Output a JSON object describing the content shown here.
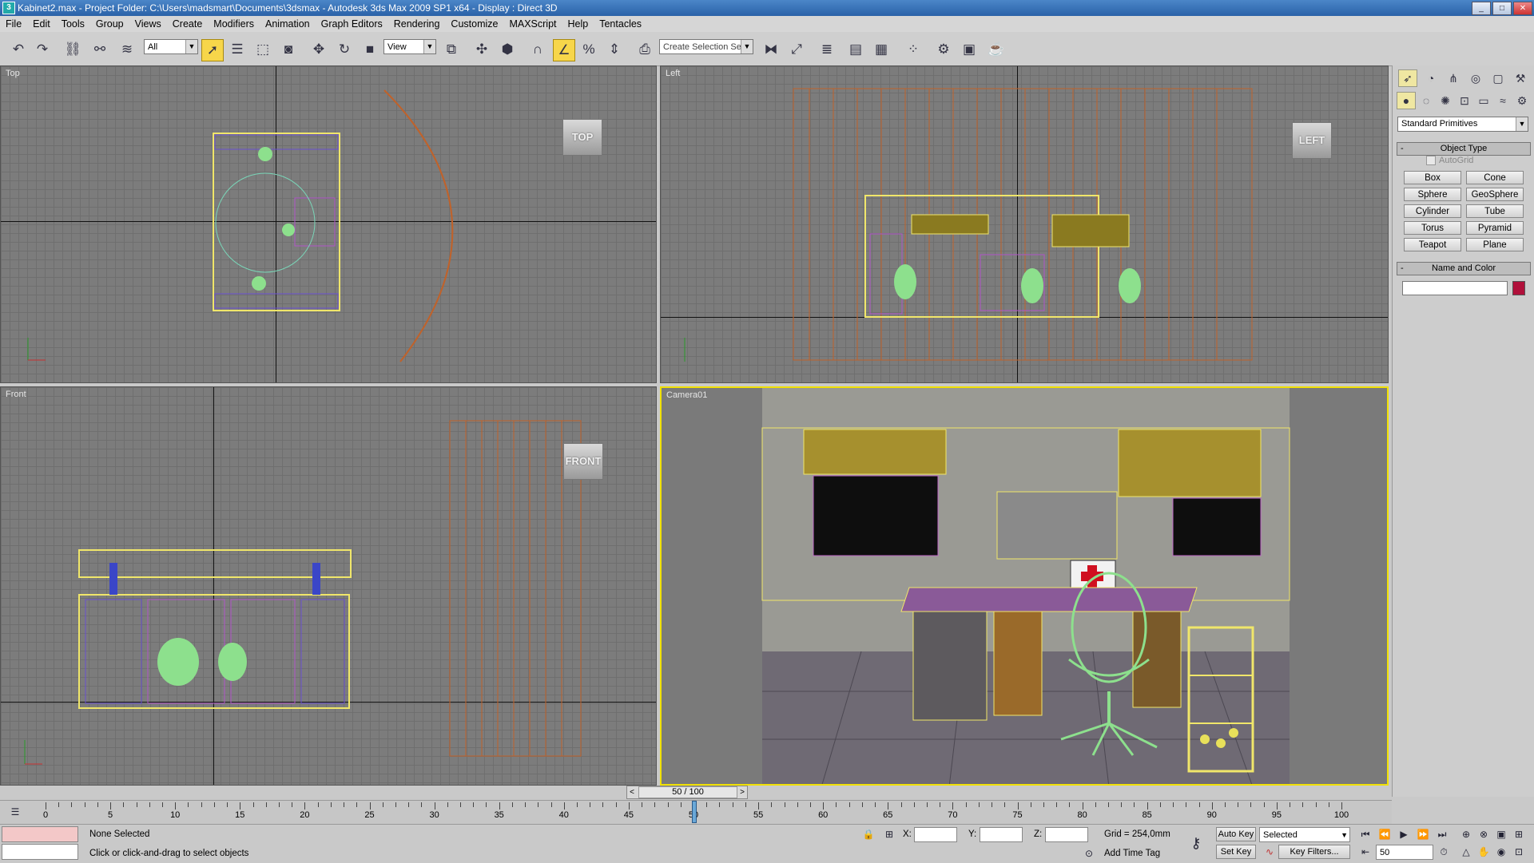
{
  "titlebar": {
    "title": "Kabinet2.max     - Project Folder: C:\\Users\\madsmart\\Documents\\3dsmax     - Autodesk 3ds Max  2009 SP1  x64      - Display : Direct 3D",
    "app_icon": "3ds-max-icon"
  },
  "menu": [
    "File",
    "Edit",
    "Tools",
    "Group",
    "Views",
    "Create",
    "Modifiers",
    "Animation",
    "Graph Editors",
    "Rendering",
    "Customize",
    "MAXScript",
    "Help",
    "Tentacles"
  ],
  "toolbar": {
    "selection_filter": "All",
    "reference_coord": "View",
    "named_selection_placeholder": "Create Selection Set"
  },
  "viewports": {
    "top": {
      "label": "Top",
      "cube": "TOP"
    },
    "left": {
      "label": "Left",
      "cube": "LEFT"
    },
    "front": {
      "label": "Front",
      "cube": "FRONT"
    },
    "camera": {
      "label": "Camera01"
    }
  },
  "command_panel": {
    "category": "Standard Primitives",
    "object_type_title": "Object Type",
    "autogrid": "AutoGrid",
    "primitives": [
      "Box",
      "Cone",
      "Sphere",
      "GeoSphere",
      "Cylinder",
      "Tube",
      "Torus",
      "Pyramid",
      "Teapot",
      "Plane"
    ],
    "name_color_title": "Name and Color",
    "object_color": "#b0103a"
  },
  "timeline": {
    "frame_display": "50 / 100",
    "current_frame": 50,
    "ticks": [
      "0",
      "5",
      "10",
      "15",
      "20",
      "25",
      "30",
      "35",
      "40",
      "45",
      "50",
      "55",
      "60",
      "65",
      "70",
      "75",
      "80",
      "85",
      "90",
      "95",
      "100"
    ]
  },
  "status": {
    "selection": "None Selected",
    "prompt": "Click or click-and-drag to select objects",
    "x_label": "X:",
    "y_label": "Y:",
    "z_label": "Z:",
    "grid": "Grid = 254,0mm",
    "add_time_tag": "Add Time Tag",
    "auto_key": "Auto Key",
    "set_key": "Set Key",
    "key_mode": "Selected",
    "key_filters": "Key Filters...",
    "frame_field": "50"
  },
  "colors": {
    "active_viewport_border": "#f0e000",
    "accent_button": "#f7d64a"
  }
}
